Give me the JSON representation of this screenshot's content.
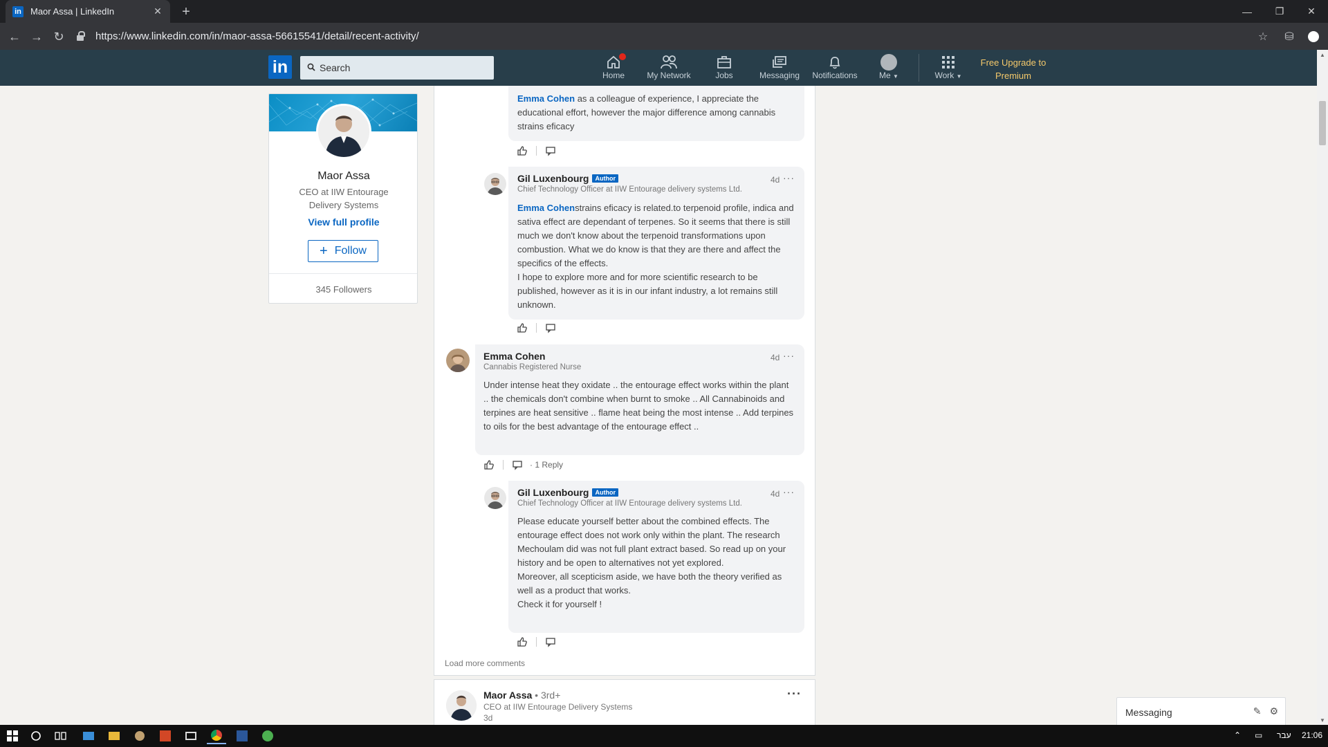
{
  "browser": {
    "tab_title": "Maor Assa | LinkedIn",
    "tab_favicon": "in",
    "url": "https://www.linkedin.com/in/maor-assa-56615541/detail/recent-activity/"
  },
  "linkedin_nav": {
    "logo": "in",
    "search_placeholder": "Search",
    "items": [
      {
        "label": "Home",
        "icon": "home-icon"
      },
      {
        "label": "My Network",
        "icon": "network-icon"
      },
      {
        "label": "Jobs",
        "icon": "briefcase-icon"
      },
      {
        "label": "Messaging",
        "icon": "messaging-icon"
      },
      {
        "label": "Notifications",
        "icon": "bell-icon"
      },
      {
        "label": "Me",
        "icon": "avatar"
      },
      {
        "label": "Work",
        "icon": "grid-icon"
      }
    ],
    "premium_line1": "Free Upgrade to",
    "premium_line2": "Premium"
  },
  "profile": {
    "name": "Maor Assa",
    "title": "CEO at IIW Entourage Delivery Systems",
    "view_profile": "View full profile",
    "follow": "Follow",
    "followers": "345 Followers"
  },
  "comments": [
    {
      "mention": "Emma Cohen",
      "text": " as a colleague of experience, I appreciate the educational effort, however the major difference among cannabis strains eficacy"
    },
    {
      "name": "Gil Luxenbourg",
      "badge": "Author",
      "headline": "Chief Technology Officer at IIW Entourage delivery systems Ltd.",
      "time": "4d",
      "mention": "Emma Cohen",
      "text": "strains eficacy is related.to terpenoid profile, indica and sativa effect are dependant of terpenes. So it seems that there is still much we don't know about the terpenoid transformations upon combustion. What we do know is that they are there and affect the specifics of the effects.\nI hope to explore more and for more scientific research to be published, however as it is in our infant industry, a lot remains still unknown."
    },
    {
      "name": "Emma Cohen",
      "headline": "Cannabis Registered Nurse",
      "time": "4d",
      "text": "Under intense heat they oxidate ..  the entourage effect works within the plant .. the chemicals don't combine when burnt to smoke .. All Cannabinoids and terpines are heat sensitive .. flame heat being the most intense .. Add terpines to oils for the best advantage of the entourage effect ..",
      "reply_count": "1 Reply"
    },
    {
      "name": "Gil Luxenbourg",
      "badge": "Author",
      "headline": "Chief Technology Officer at IIW Entourage delivery systems Ltd.",
      "time": "4d",
      "text": "Please educate yourself better about the combined effects. The entourage effect does not work only within the plant. The research Mechoulam did was not full plant extract based. So read up on your history and be open to alternatives not yet explored.\nMoreover, all scepticism aside, we have both the theory verified as well as a product that works.\nCheck it for yourself !"
    }
  ],
  "load_more": "Load more comments",
  "next_post": {
    "name": "Maor Assa",
    "degree": " • 3rd+",
    "headline": "CEO at IIW Entourage Delivery Systems",
    "time": "3d"
  },
  "messaging_widget": {
    "label": "Messaging"
  },
  "taskbar": {
    "lang": "עבר",
    "clock": "21:06"
  }
}
